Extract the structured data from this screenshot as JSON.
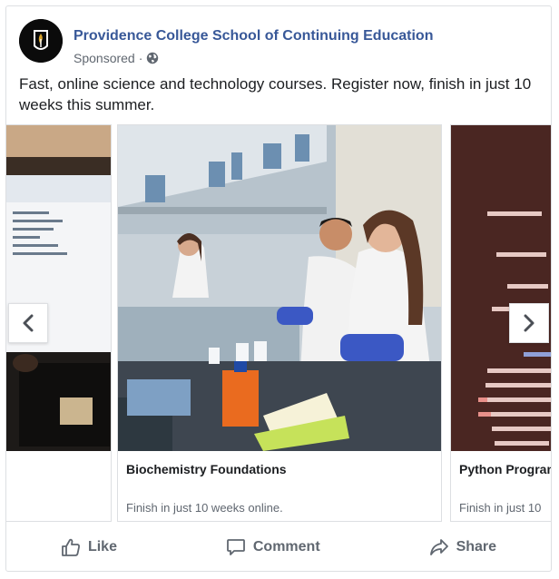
{
  "post": {
    "page_name": "Providence College School of Continuing Education",
    "meta_label": "Sponsored",
    "meta_separator": "·",
    "privacy_icon": "globe-icon",
    "body_text": "Fast, online science and technology courses. Register now, finish in just 10 weeks this summer."
  },
  "carousel": {
    "cards": [
      {
        "title": "",
        "description": "",
        "image": "laptop-code-photo"
      },
      {
        "title": "Biochemistry Foundations",
        "description": "Finish in just 10 weeks online.",
        "image": "lab-students-photo"
      },
      {
        "title": "Python Program",
        "description": "Finish in just 10",
        "image": "code-screen-photo"
      }
    ],
    "prev_icon": "chevron-left-icon",
    "next_icon": "chevron-right-icon"
  },
  "actions": {
    "like_label": "Like",
    "comment_label": "Comment",
    "share_label": "Share"
  },
  "colors": {
    "link_blue": "#385898",
    "secondary_text": "#606770",
    "border": "#dddfe2"
  }
}
